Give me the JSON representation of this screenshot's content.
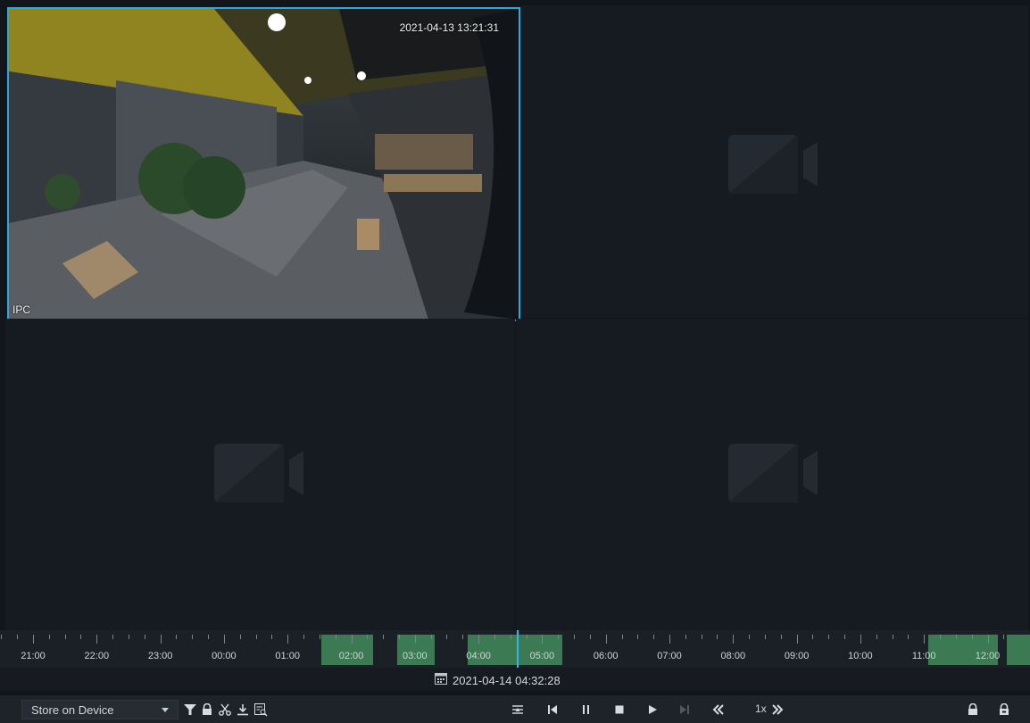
{
  "video_grid": {
    "panes": [
      {
        "selected": true,
        "has_video": true,
        "osd_time": "2021-04-13 13:21:31",
        "osd_name": "IPC"
      },
      {
        "selected": false,
        "has_video": false
      },
      {
        "selected": false,
        "has_video": false
      },
      {
        "selected": false,
        "has_video": false
      }
    ],
    "placeholder_icon": "video-camera-icon"
  },
  "timeline": {
    "hours": [
      "21:00",
      "22:00",
      "23:00",
      "00:00",
      "01:00",
      "02:00",
      "03:00",
      "04:00",
      "05:00",
      "06:00",
      "07:00",
      "08:00",
      "09:00",
      "10:00",
      "11:00",
      "12:00"
    ],
    "record_color": "#3c7a53",
    "cursor_color": "#35b4ee"
  },
  "date_display": {
    "icon": "calendar-icon",
    "value": "2021-04-14 04:32:28"
  },
  "toolbar": {
    "storage_select": {
      "value": "Store on Device"
    },
    "left_tools": [
      "filter-icon",
      "lock-icon",
      "scissors-icon",
      "download-icon",
      "search-record-icon"
    ],
    "playback_controls": [
      "sync-icon",
      "previous-frame-icon",
      "pause-icon",
      "stop-icon",
      "play-icon",
      "next-frame-icon",
      "slow-down-icon",
      "speed-up-icon"
    ],
    "speed": "1x",
    "right_tools": [
      "lock-closed-icon",
      "lock-open-icon"
    ],
    "accent": "#2aa9e0"
  }
}
